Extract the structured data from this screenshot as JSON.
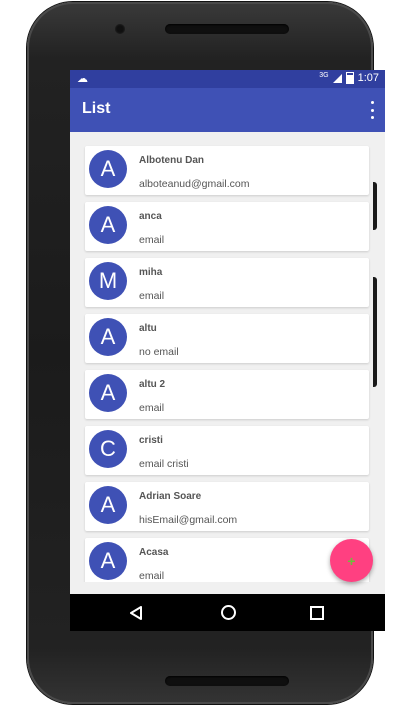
{
  "statusbar": {
    "network": "3G",
    "time": "1:07"
  },
  "toolbar": {
    "title": "List"
  },
  "contacts": [
    {
      "initial": "A",
      "name": "Albotenu Dan",
      "email": "alboteanud@gmail.com"
    },
    {
      "initial": "A",
      "name": "anca",
      "email": "email"
    },
    {
      "initial": "M",
      "name": "miha",
      "email": "email"
    },
    {
      "initial": "A",
      "name": "altu",
      "email": "no email"
    },
    {
      "initial": "A",
      "name": "altu 2",
      "email": "email"
    },
    {
      "initial": "C",
      "name": "cristi",
      "email": "email cristi"
    },
    {
      "initial": "A",
      "name": "Adrian Soare",
      "email": "hisEmail@gmail.com"
    },
    {
      "initial": "A",
      "name": "Acasa",
      "email": "email"
    }
  ],
  "fab": {
    "icon": "add-icon",
    "label": "+"
  },
  "colors": {
    "primary": "#3f51b5",
    "primary_dark": "#303f9f",
    "accent": "#ff4081"
  }
}
